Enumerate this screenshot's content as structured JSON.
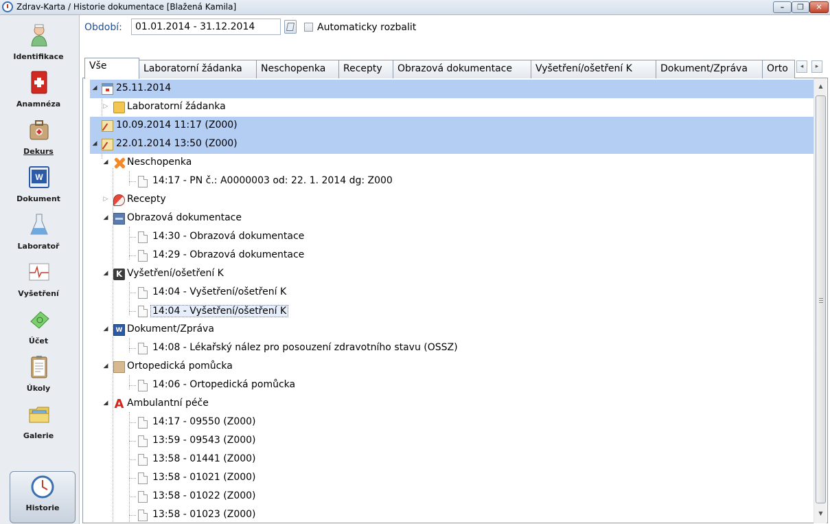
{
  "window": {
    "title": "Zdrav-Karta / Historie dokumentace [Blažená  Kamila]",
    "min_glyph": "–",
    "max_glyph": "❐",
    "close_glyph": "✕"
  },
  "sidebar": {
    "items": [
      {
        "label": "Identifikace",
        "icon": "nurse-icon"
      },
      {
        "label": "Anamnéza",
        "icon": "medical-book-icon"
      },
      {
        "label": "Dekurs",
        "icon": "medical-bag-icon"
      },
      {
        "label": "Dokument",
        "icon": "word-document-icon"
      },
      {
        "label": "Laboratoř",
        "icon": "flask-icon"
      },
      {
        "label": "Vyšetření",
        "icon": "ecg-icon"
      },
      {
        "label": "Účet",
        "icon": "money-icon"
      },
      {
        "label": "Úkoly",
        "icon": "clipboard-icon"
      },
      {
        "label": "Galerie",
        "icon": "folder-icon"
      },
      {
        "label": "Historie",
        "icon": "clock-icon"
      }
    ]
  },
  "period": {
    "label": "Období:",
    "value": "01.01.2014 - 31.12.2014",
    "auto_expand_label": "Automaticky rozbalit",
    "auto_expand_checked": false
  },
  "tabs": [
    "Vše",
    "Laboratorní žádanka",
    "Neschopenka",
    "Recepty",
    "Obrazová dokumentace",
    "Vyšetření/ošetření K",
    "Dokument/Zpráva",
    "Orto"
  ],
  "tree": [
    {
      "text": "25.11.2014"
    },
    {
      "text": "Laboratorní žádanka"
    },
    {
      "text": "10.09.2014 11:17 (Z000)"
    },
    {
      "text": "22.01.2014 13:50 (Z000)"
    },
    {
      "text": "Neschopenka"
    },
    {
      "text": "14:17 - PN č.: A0000003 od: 22. 1. 2014 dg: Z000"
    },
    {
      "text": "Recepty"
    },
    {
      "text": "Obrazová dokumentace"
    },
    {
      "text": "14:30 - Obrazová dokumentace"
    },
    {
      "text": "14:29 - Obrazová dokumentace"
    },
    {
      "text": "Vyšetření/ošetření K"
    },
    {
      "text": "14:04 - Vyšetření/ošetření K"
    },
    {
      "text": "14:04 - Vyšetření/ošetření K"
    },
    {
      "text": "Dokument/Zpráva"
    },
    {
      "text": "14:08 - Lékařský nález pro posouzení zdravotního stavu (OSSZ)"
    },
    {
      "text": "Ortopedická pomůcka"
    },
    {
      "text": "14:06 - Ortopedická pomůcka"
    },
    {
      "text": "Ambulantní péče"
    },
    {
      "text": "14:17 - 09550 (Z000)"
    },
    {
      "text": "13:59 - 09543 (Z000)"
    },
    {
      "text": "13:58 - 01441 (Z000)"
    },
    {
      "text": "13:58 - 01021 (Z000)"
    },
    {
      "text": "13:58 - 01022 (Z000)"
    },
    {
      "text": "13:58 - 01023 (Z000)"
    }
  ],
  "tree_icons": {
    "k_letter": "K",
    "word_letter": "W",
    "a_letter": "A"
  },
  "glyphs": {
    "expanded": "◢",
    "collapsed": "▷",
    "tab_left": "◂",
    "tab_right": "▸",
    "scroll_up": "▲",
    "scroll_down": "▼"
  }
}
